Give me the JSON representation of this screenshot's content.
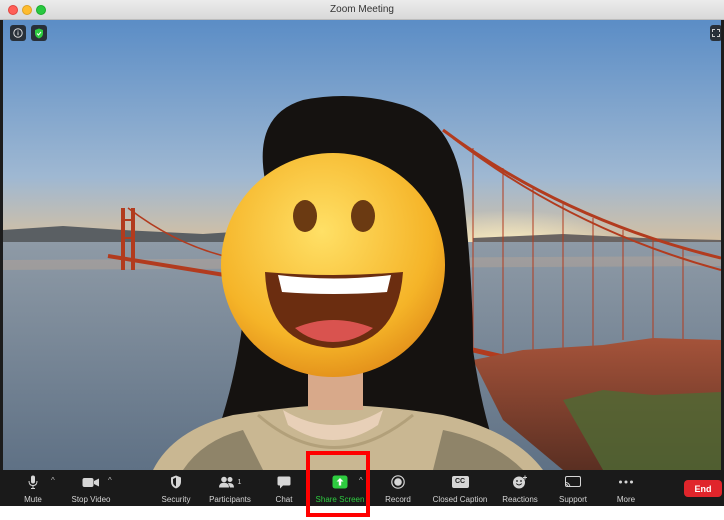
{
  "window": {
    "title": "Zoom Meeting"
  },
  "toolbar": {
    "mute_label": "Mute",
    "stop_video_label": "Stop Video",
    "security_label": "Security",
    "participants_label": "Participants",
    "participants_count": "1",
    "chat_label": "Chat",
    "share_screen_label": "Share Screen",
    "record_label": "Record",
    "closed_caption_label": "Closed Caption",
    "closed_caption_badge": "CC",
    "reactions_label": "Reactions",
    "support_label": "Support",
    "more_label": "More",
    "end_label": "End"
  },
  "colors": {
    "share_accent": "#2ecc40",
    "end_button": "#e0252b",
    "highlight_box": "#ff0000"
  },
  "icons": [
    "info-icon",
    "shield-icon",
    "fullscreen-icon",
    "microphone-icon",
    "video-camera-icon",
    "security-shield-icon",
    "participants-icon",
    "chat-bubble-icon",
    "share-screen-icon",
    "record-icon",
    "closed-caption-icon",
    "reactions-icon",
    "support-icon",
    "more-dots-icon"
  ]
}
